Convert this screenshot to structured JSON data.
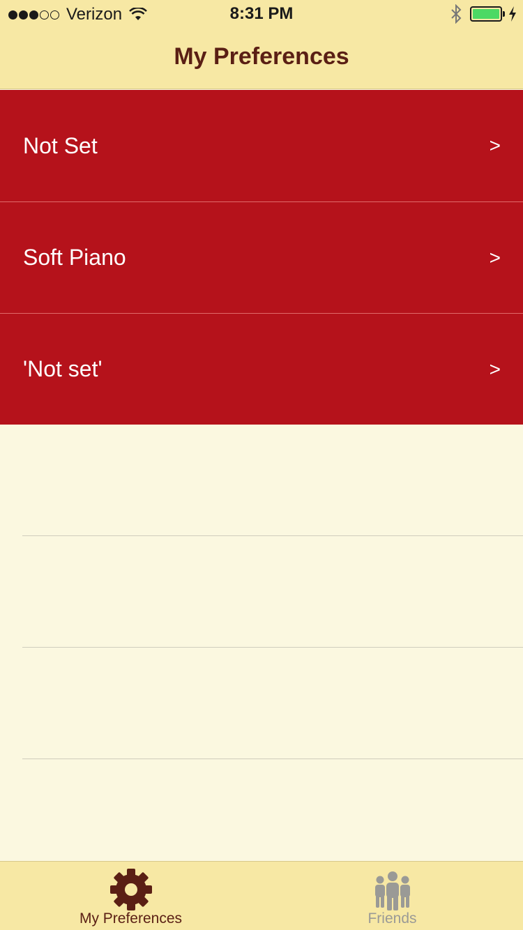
{
  "status_bar": {
    "carrier": "Verizon",
    "time": "8:31 PM",
    "signal_bars": 3,
    "signal_total": 5,
    "battery_level": 1.0
  },
  "nav": {
    "title": "My Preferences"
  },
  "preferences": [
    {
      "label": "Not Set",
      "chevron": ">"
    },
    {
      "label": "Soft Piano",
      "chevron": ">"
    },
    {
      "label": "'Not set'",
      "chevron": ">"
    }
  ],
  "tabbar": {
    "tabs": [
      {
        "label": "My Preferences",
        "icon": "gear-icon",
        "active": true
      },
      {
        "label": "Friends",
        "icon": "people-icon",
        "active": false
      }
    ]
  },
  "colors": {
    "row_background": "#b5121b",
    "bar_background": "#f7e8a4",
    "page_background": "#fbf8e0",
    "title_color": "#5a1f14",
    "inactive_tab": "#9a9a96",
    "battery": "#4cd964"
  }
}
